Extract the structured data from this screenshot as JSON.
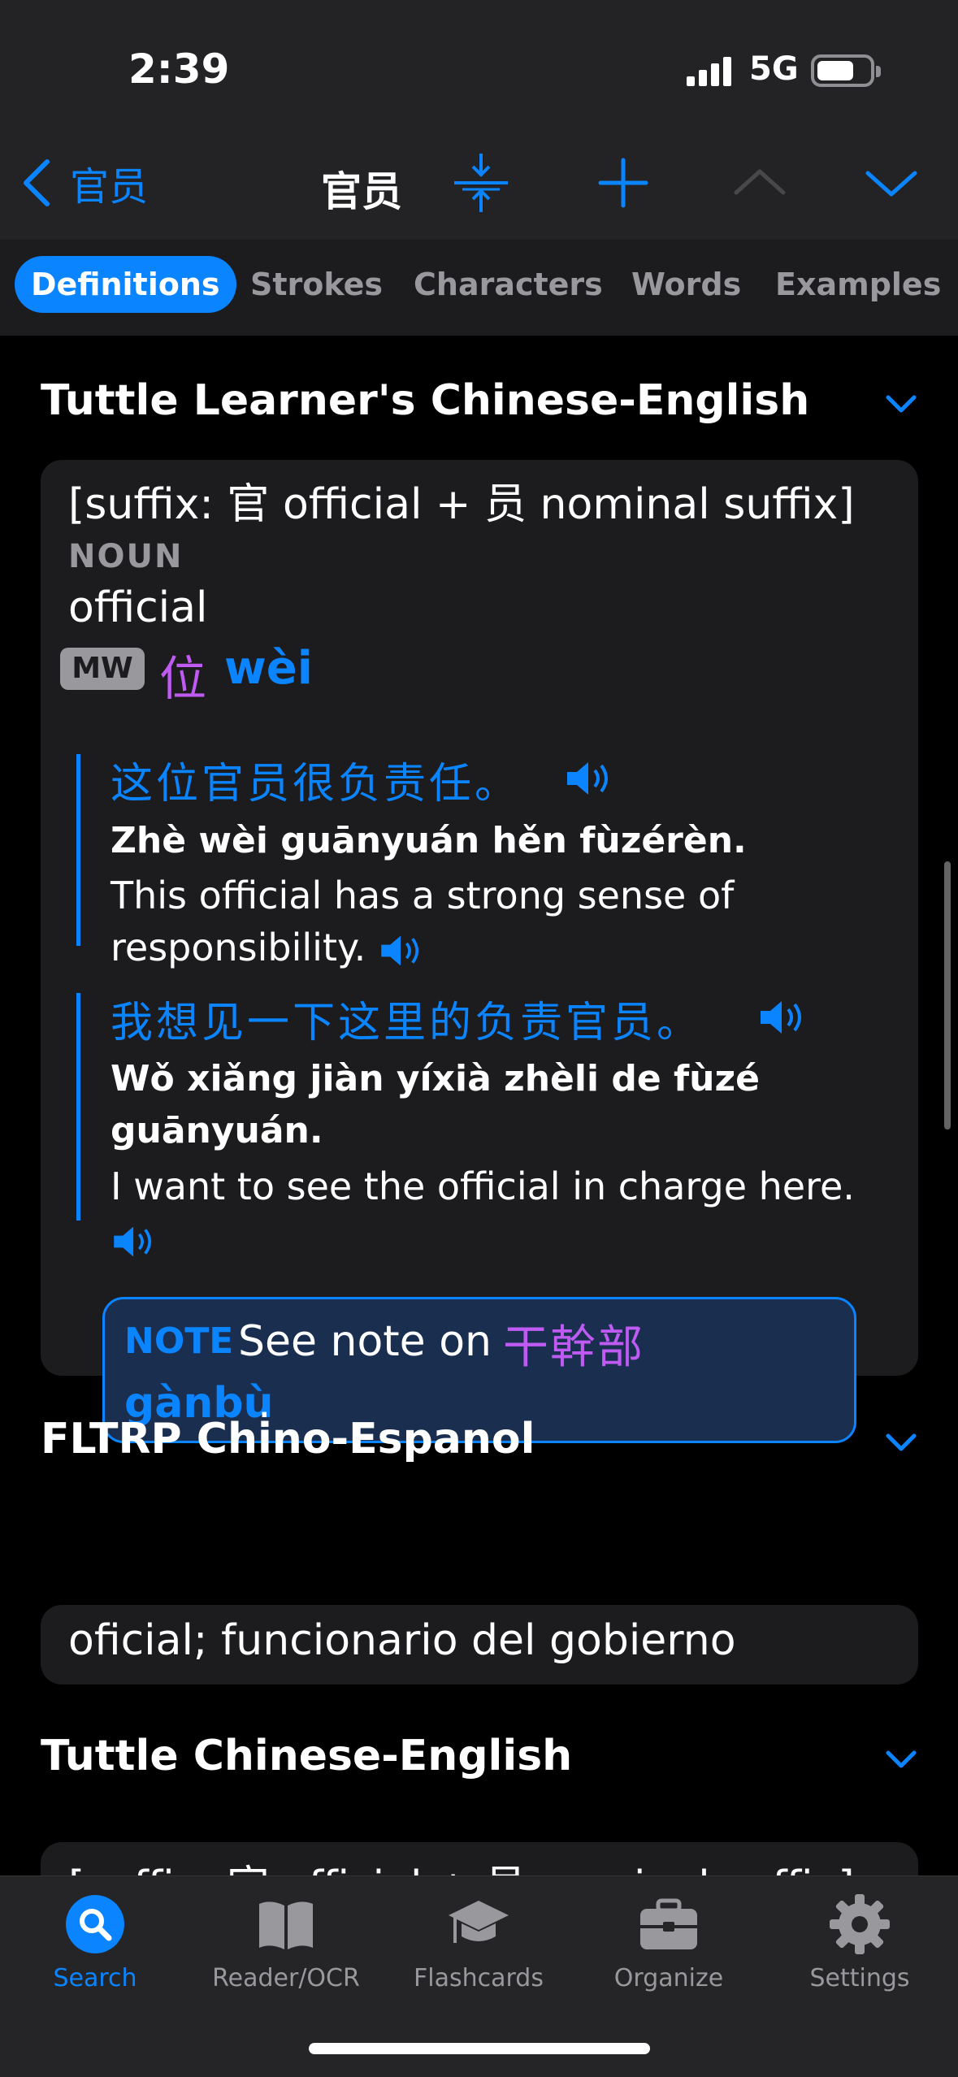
{
  "status_bar": {
    "time": "2:39",
    "network": "5G"
  },
  "nav": {
    "back_label": "官员",
    "title": "官员",
    "icons": [
      "compress-icon",
      "plus-icon",
      "chevron-up-icon",
      "chevron-down-icon"
    ]
  },
  "tabs": [
    {
      "label": "Definitions",
      "active": true
    },
    {
      "label": "Strokes"
    },
    {
      "label": "Characters"
    },
    {
      "label": "Words"
    },
    {
      "label": "Examples"
    }
  ],
  "sections": [
    {
      "title": "Tuttle Learner's Chinese-English",
      "etymology": "[suffix: 官 official + 员 nominal suffix]",
      "pos": "NOUN",
      "definition": "official",
      "measure_word": {
        "label": "MW",
        "hanzi": "位",
        "pinyin": "wèi"
      },
      "examples": [
        {
          "hanzi": "这位官员很负责任。",
          "pinyin_before": "Zhè wèi ",
          "pinyin_bold": "guānyuán",
          "pinyin_after": " hěn fùzérèn.",
          "translation": "This official has a strong sense of responsibility."
        },
        {
          "hanzi": "我想见一下这里的负责官员。",
          "pinyin_before": "Wǒ xiǎng jiàn yíxià zhèli de fùzé ",
          "pinyin_bold": "guānyuán",
          "pinyin_after": ".",
          "translation": "I want to see the official in charge here."
        }
      ],
      "note": {
        "label": "NOTE",
        "text": "See note on",
        "hanzi": "干幹部",
        "pinyin": "gànbù",
        "end": "."
      }
    },
    {
      "title": "FLTRP Chino-Espanol",
      "definition": "oficial; funcionario del gobierno"
    },
    {
      "title": "Tuttle Chinese-English",
      "etymology": "[suffix: 官 official + 员 nominal suffix]"
    }
  ],
  "tabbar": [
    {
      "label": "Search",
      "icon": "search-icon",
      "active": true
    },
    {
      "label": "Reader/OCR",
      "icon": "book-icon"
    },
    {
      "label": "Flashcards",
      "icon": "graduation-cap-icon"
    },
    {
      "label": "Organize",
      "icon": "toolbox-icon"
    },
    {
      "label": "Settings",
      "icon": "gear-icon"
    }
  ],
  "colors": {
    "accent": "#0a84ff",
    "purple": "#bf5af2",
    "background": "#000000",
    "card": "#1c1c1e"
  }
}
